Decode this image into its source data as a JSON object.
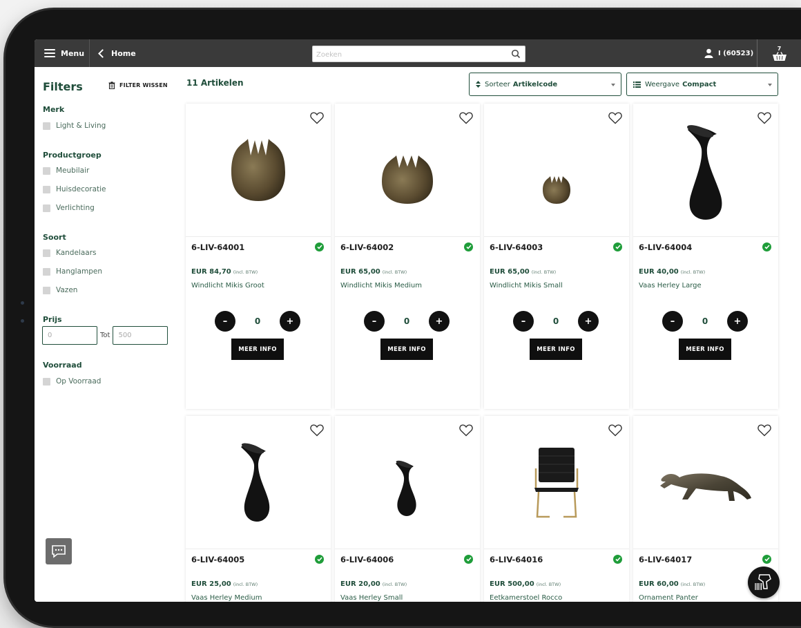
{
  "topbar": {
    "menu_label": "Menu",
    "home_label": "Home",
    "search_placeholder": "Zoeken",
    "user_label": "I (60523)",
    "cart_count": "7"
  },
  "sidebar": {
    "title": "Filters",
    "clear_label": "FILTER WISSEN",
    "sections": {
      "merk": {
        "title": "Merk",
        "items": [
          "Light & Living"
        ]
      },
      "productgroep": {
        "title": "Productgroep",
        "items": [
          "Meubilair",
          "Huisdecoratie",
          "Verlichting"
        ]
      },
      "soort": {
        "title": "Soort",
        "items": [
          "Kandelaars",
          "Hanglampen",
          "Vazen"
        ]
      },
      "prijs": {
        "title": "Prijs",
        "from_placeholder": "0",
        "to_label": "Tot",
        "to_placeholder": "500"
      },
      "voorraad": {
        "title": "Voorraad",
        "items": [
          "Op Voorraad"
        ]
      }
    }
  },
  "toolbar": {
    "article_count": "11 Artikelen",
    "sort_prefix": "Sorteer",
    "sort_value": "Artikelcode",
    "view_prefix": "Weergave",
    "view_value": "Compact"
  },
  "products": [
    {
      "code": "6-LIV-64001",
      "price": "EUR 84,70",
      "vat": "(incl. BTW)",
      "name": "Windlicht Mikis Groot",
      "qty": "0",
      "more": "MEER INFO",
      "image": "bronze-tulip-large"
    },
    {
      "code": "6-LIV-64002",
      "price": "EUR 65,00",
      "vat": "(incl. BTW)",
      "name": "Windlicht Mikis Medium",
      "qty": "0",
      "more": "MEER INFO",
      "image": "bronze-tulip-medium"
    },
    {
      "code": "6-LIV-64003",
      "price": "EUR 65,00",
      "vat": "(incl. BTW)",
      "name": "Windlicht Mikis Small",
      "qty": "0",
      "more": "MEER INFO",
      "image": "bronze-tulip-small"
    },
    {
      "code": "6-LIV-64004",
      "price": "EUR 40,00",
      "vat": "(incl. BTW)",
      "name": "Vaas Herley Large",
      "qty": "0",
      "more": "MEER INFO",
      "image": "black-vase-large"
    },
    {
      "code": "6-LIV-64005",
      "price": "EUR 25,00",
      "vat": "(incl. BTW)",
      "name": "Vaas Herley Medium",
      "image": "black-vase-medium"
    },
    {
      "code": "6-LIV-64006",
      "price": "EUR 20,00",
      "vat": "(incl. BTW)",
      "name": "Vaas Herley Small",
      "image": "black-vase-small"
    },
    {
      "code": "6-LIV-64016",
      "price": "EUR 500,00",
      "vat": "(incl. BTW)",
      "name": "Eetkamerstoel Rocco",
      "image": "black-chair"
    },
    {
      "code": "6-LIV-64017",
      "price": "EUR 60,00",
      "vat": "(incl. BTW)",
      "name": "Ornament Panter",
      "image": "bronze-panther"
    }
  ],
  "colors": {
    "brand_green": "#1f4d3a",
    "stock_green": "#1f9d3a",
    "topbar": "#3a3a3a"
  }
}
